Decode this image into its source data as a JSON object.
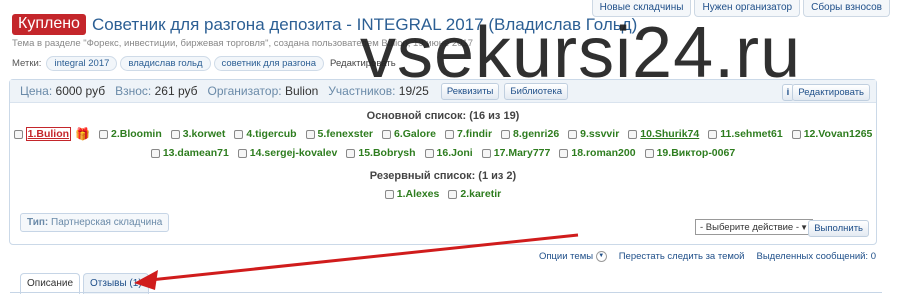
{
  "top_buttons": [
    "Новые складчины",
    "Нужен организатор",
    "Сборы взносов"
  ],
  "thread": {
    "badge": "Куплено",
    "title": "Советник для разгона депозита - INTEGRAL 2017 (Владислав Гольд)",
    "subtitle": "Тема в разделе \"Форекс, инвестиции, биржевая торговля\", создана пользователем Bulion, 19 июне 2017"
  },
  "tags": {
    "label": "Метки:",
    "items": [
      "integral 2017",
      "владислав гольд",
      "советник для разгона"
    ],
    "edit": "Редактировать"
  },
  "info": {
    "price_label": "Цена:",
    "price": "6000 руб",
    "fee_label": "Взнос:",
    "fee": "261 руб",
    "org_label": "Организатор:",
    "org": "Bulion",
    "members_label": "Участников:",
    "members": "19/25",
    "requisites": "Реквизиты",
    "library": "Библиотека",
    "info_btn": "i",
    "edit_btn": "Редактировать"
  },
  "main_list": {
    "title": "Основной список: (16 из 19)",
    "row1": [
      "1.Bulion",
      "2.Bloomin",
      "3.korwet",
      "4.tigercub",
      "5.fenexster",
      "6.Galore",
      "7.findir",
      "8.genri26",
      "9.ssvvir",
      "10.Shurik74",
      "11.sehmet61",
      "12.Vovan1265"
    ],
    "row2": [
      "13.damean71",
      "14.sergej-kovalev",
      "15.Bobrysh",
      "16.Joni",
      "17.Mary777",
      "18.roman200",
      "19.Виктор-0067"
    ]
  },
  "reserve_list": {
    "title": "Резервный список: (1 из 2)",
    "items": [
      "1.Alexes",
      "2.karetir"
    ]
  },
  "type_box": {
    "label": "Тип:",
    "value": "Партнерская складчина"
  },
  "action": {
    "select_value": "- Выберите действие -",
    "run": "Выполнить"
  },
  "below": {
    "options": "Опции темы",
    "unwatch": "Перестать следить за темой",
    "selected": "Выделенных сообщений: 0"
  },
  "tabs": [
    "Описание",
    "Отзывы (1)"
  ],
  "watermark": "vsekursi24.ru",
  "colors": {
    "accent": "#2c5f94",
    "badge": "#c4262b",
    "member_green": "#2e7d1f",
    "arrow": "#d01c1c"
  }
}
